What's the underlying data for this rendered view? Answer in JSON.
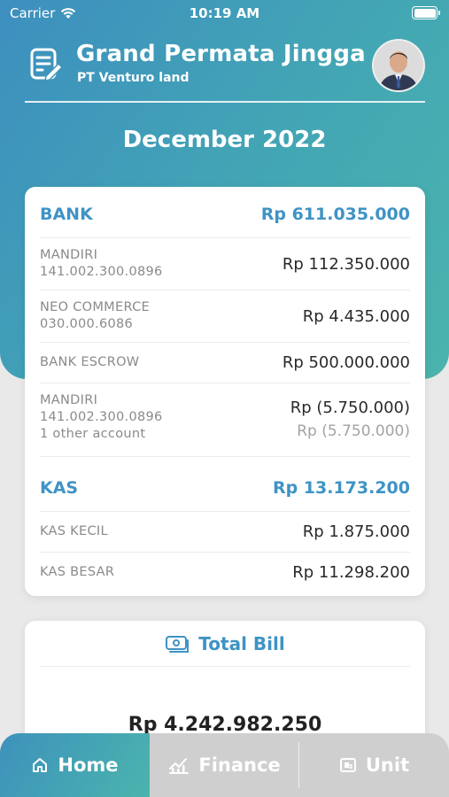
{
  "status_bar": {
    "carrier": "Carrier",
    "time": "10:19 AM"
  },
  "header": {
    "title": "Grand Permata Jingga",
    "subtitle": "PT Venturo land",
    "period": "December 2022"
  },
  "bank": {
    "label": "BANK",
    "total": "Rp 611.035.000",
    "accounts": [
      {
        "name": "MANDIRI",
        "number": "141.002.300.0896",
        "amount": "Rp 112.350.000"
      },
      {
        "name": "NEO COMMERCE",
        "number": "030.000.6086",
        "amount": "Rp 4.435.000"
      },
      {
        "name": "BANK ESCROW",
        "amount": "Rp 500.000.000"
      },
      {
        "name": "MANDIRI",
        "number": "141.002.300.0896",
        "extra": "1 other account",
        "amount": "Rp (5.750.000)",
        "amount_sub": "Rp (5.750.000)"
      }
    ]
  },
  "kas": {
    "label": "KAS",
    "total": "Rp 13.173.200",
    "accounts": [
      {
        "name": "KAS KECIL",
        "amount": "Rp 1.875.000"
      },
      {
        "name": "KAS BESAR",
        "amount": "Rp 11.298.200"
      }
    ]
  },
  "bill": {
    "label": "Total Bill",
    "amount": "Rp 4.242.982.250"
  },
  "tabs": [
    {
      "label": "Home",
      "icon": "home-icon",
      "active": true
    },
    {
      "label": "Finance",
      "icon": "finance-chart-icon",
      "active": false
    },
    {
      "label": "Unit",
      "icon": "unit-icon",
      "active": false
    }
  ],
  "colors": {
    "accent": "#3f93c5",
    "hero_start": "#3d8fbf",
    "hero_end": "#4bb4ad"
  }
}
